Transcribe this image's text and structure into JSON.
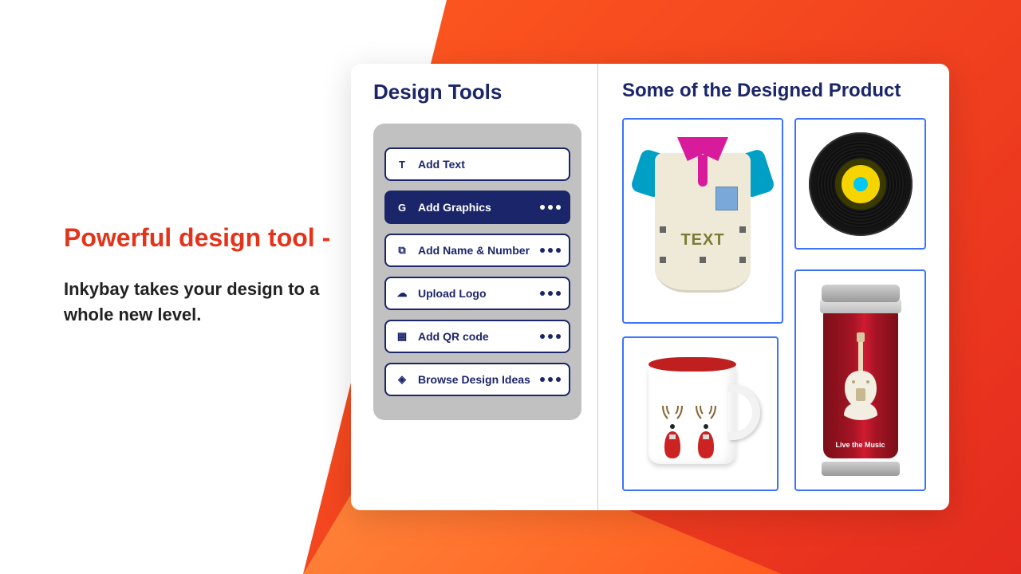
{
  "hero": {
    "title": "Powerful design tool -",
    "subtitle": "Inkybay takes your design to a whole new level."
  },
  "design_tools": {
    "heading": "Design  Tools",
    "items": [
      {
        "icon": "T",
        "icon_name": "text-icon",
        "label": "Add Text",
        "active": false,
        "dots": false
      },
      {
        "icon": "G",
        "icon_name": "graphics-icon",
        "label": "Add Graphics",
        "active": true,
        "dots": true
      },
      {
        "icon": "⧉",
        "icon_name": "name-number-icon",
        "label": "Add Name & Number",
        "active": false,
        "dots": true
      },
      {
        "icon": "☁",
        "icon_name": "upload-icon",
        "label": "Upload Logo",
        "active": false,
        "dots": true
      },
      {
        "icon": "▦",
        "icon_name": "qr-icon",
        "label": "Add QR code",
        "active": false,
        "dots": true
      },
      {
        "icon": "◈",
        "icon_name": "ideas-icon",
        "label": "Browse Design Ideas",
        "active": false,
        "dots": true
      }
    ]
  },
  "designed_products": {
    "heading": "Some of the Designed Product",
    "shirt_text": "TEXT",
    "tumbler_text": "Live the Music"
  },
  "colors": {
    "brand_navy": "#1b256a",
    "accent_blue": "#3b72ff",
    "orange_start": "#ff5a1f",
    "orange_end": "#e42b1f"
  }
}
